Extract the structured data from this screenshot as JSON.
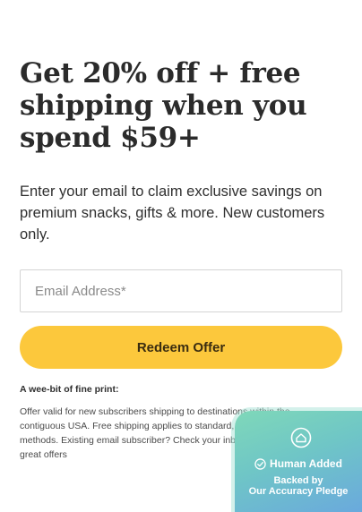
{
  "offer": {
    "headline": "Get 20% off + free shipping when you spend $59+",
    "subtext": "Enter your email to claim exclusive savings on premium snacks, gifts & more. New customers only.",
    "email_placeholder": "Email Address*",
    "redeem_label": "Redeem Offer",
    "fine_print_title": "A wee-bit of fine print:",
    "fine_print_body": "Offer valid for new subscribers shipping to destinations within the contiguous USA. Free shipping applies to standard, \"ground\" shipping methods. Existing email subscriber? Check your inbox weekly for other great offers"
  },
  "badge": {
    "title": "Human Added",
    "line1": "Backed by",
    "line2": "Our Accuracy Pledge",
    "logo_icon": "house-shield-icon",
    "check_icon": "check-circle-icon"
  },
  "colors": {
    "button": "#fcc83c",
    "badge_start": "#7fd8b9",
    "badge_end": "#6aa9dd"
  }
}
